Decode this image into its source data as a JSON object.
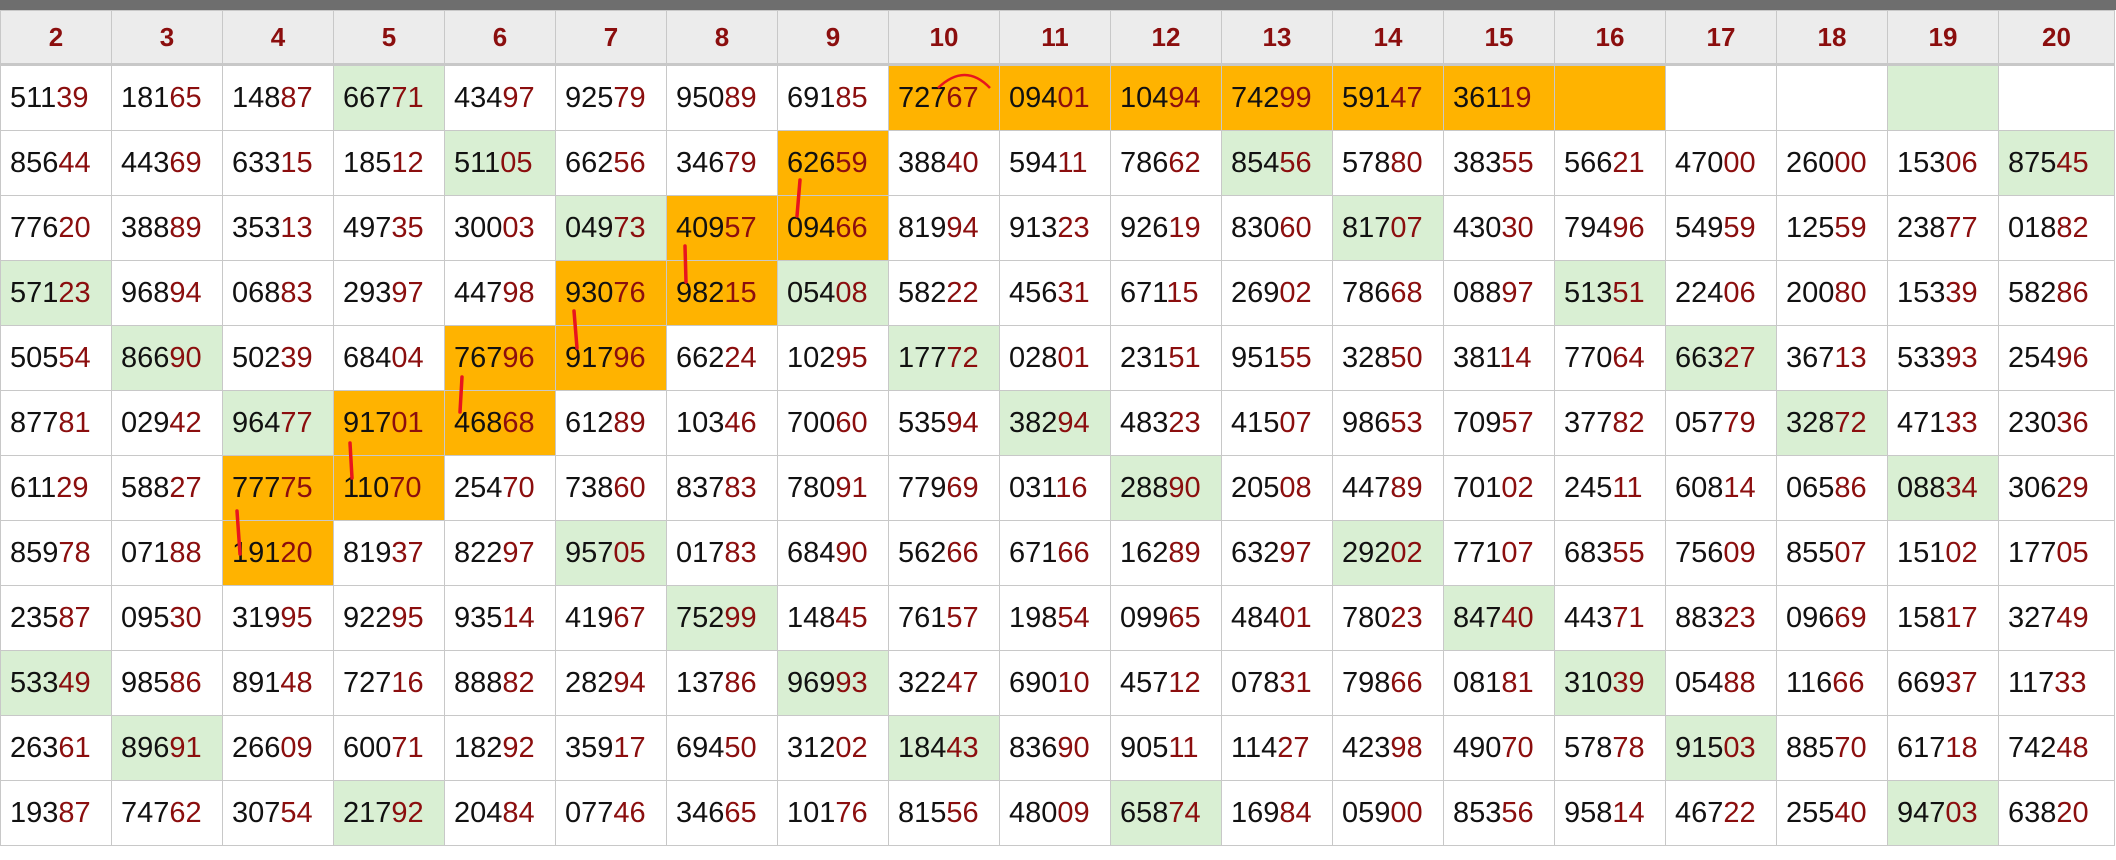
{
  "headers": [
    "2",
    "3",
    "4",
    "5",
    "6",
    "7",
    "8",
    "9",
    "10",
    "11",
    "12",
    "13",
    "14",
    "15",
    "16",
    "17",
    "18",
    "19",
    "20"
  ],
  "rows": [
    [
      "51139",
      "18165",
      "14887",
      "66771",
      "43497",
      "92579",
      "95089",
      "69185",
      "72767",
      "09401",
      "10494",
      "74299",
      "59147",
      "36119",
      "",
      "",
      "",
      "",
      ""
    ],
    [
      "85644",
      "44369",
      "63315",
      "18512",
      "51105",
      "66256",
      "34679",
      "62659",
      "38840",
      "59411",
      "78662",
      "85456",
      "57880",
      "38355",
      "56621",
      "47000",
      "26000",
      "15306",
      "87545"
    ],
    [
      "77620",
      "38889",
      "35313",
      "49735",
      "30003",
      "04973",
      "40957",
      "09466",
      "81994",
      "91323",
      "92619",
      "83060",
      "81707",
      "43030",
      "79496",
      "54959",
      "12559",
      "23877",
      "01882"
    ],
    [
      "57123",
      "96894",
      "06883",
      "29397",
      "44798",
      "93076",
      "98215",
      "05408",
      "58222",
      "45631",
      "67115",
      "26902",
      "78668",
      "08897",
      "51351",
      "22406",
      "20080",
      "15339",
      "58286"
    ],
    [
      "50554",
      "86690",
      "50239",
      "68404",
      "76796",
      "91796",
      "66224",
      "10295",
      "17772",
      "02801",
      "23151",
      "95155",
      "32850",
      "38114",
      "77064",
      "66327",
      "36713",
      "53393",
      "25496"
    ],
    [
      "87781",
      "02942",
      "96477",
      "91701",
      "46868",
      "61289",
      "10346",
      "70060",
      "53594",
      "38294",
      "48323",
      "41507",
      "98653",
      "70957",
      "37782",
      "05779",
      "32872",
      "47133",
      "23036"
    ],
    [
      "61129",
      "58827",
      "77775",
      "11070",
      "25470",
      "73860",
      "83783",
      "78091",
      "77969",
      "03116",
      "28890",
      "20508",
      "44789",
      "70102",
      "24511",
      "60814",
      "06586",
      "08834",
      "30629"
    ],
    [
      "85978",
      "07188",
      "19120",
      "81937",
      "82297",
      "95705",
      "01783",
      "68490",
      "56266",
      "67166",
      "16289",
      "63297",
      "29202",
      "77107",
      "68355",
      "75609",
      "85507",
      "15102",
      "17705"
    ],
    [
      "23587",
      "09530",
      "31995",
      "92295",
      "93514",
      "41967",
      "75299",
      "14845",
      "76157",
      "19854",
      "09965",
      "48401",
      "78023",
      "84740",
      "44371",
      "88323",
      "09669",
      "15817",
      "32749"
    ],
    [
      "53349",
      "98586",
      "89148",
      "72716",
      "88882",
      "28294",
      "13786",
      "96993",
      "32247",
      "69010",
      "45712",
      "07831",
      "79866",
      "08181",
      "31039",
      "05488",
      "11666",
      "66937",
      "11733"
    ],
    [
      "26361",
      "89691",
      "26609",
      "60071",
      "18292",
      "35917",
      "69450",
      "31202",
      "18443",
      "83690",
      "90511",
      "11427",
      "42398",
      "49070",
      "57878",
      "91503",
      "88570",
      "61718",
      "74248"
    ],
    [
      "19387",
      "74762",
      "30754",
      "21792",
      "20484",
      "07746",
      "34665",
      "10176",
      "81556",
      "48009",
      "65874",
      "16984",
      "05900",
      "85356",
      "95814",
      "46722",
      "25540",
      "94703",
      "63820"
    ]
  ],
  "highlights": {
    "green": [
      "0-3",
      "0-17",
      "1-4",
      "1-11",
      "1-18",
      "2-5",
      "2-12",
      "3-0",
      "3-7",
      "3-14",
      "4-1",
      "4-8",
      "4-15",
      "5-2",
      "5-9",
      "5-16",
      "6-10",
      "6-17",
      "7-5",
      "7-12",
      "8-6",
      "8-13",
      "9-0",
      "9-7",
      "9-14",
      "10-1",
      "10-8",
      "10-15",
      "11-3",
      "11-10",
      "11-17"
    ],
    "orange": [
      "0-8",
      "0-9",
      "0-10",
      "0-11",
      "0-12",
      "0-13",
      "0-14",
      "1-7",
      "2-6",
      "2-7",
      "3-5",
      "3-6",
      "4-4",
      "4-5",
      "5-3",
      "5-4",
      "6-2",
      "6-3",
      "7-2"
    ]
  },
  "colors": {
    "header_text": "#8b0e0e",
    "digit_dark": "#111111",
    "digit_red": "#8b0e0e",
    "green_cell": "#d9efd3",
    "orange_cell": "#ffb300",
    "mark_line": "#e8141e"
  }
}
